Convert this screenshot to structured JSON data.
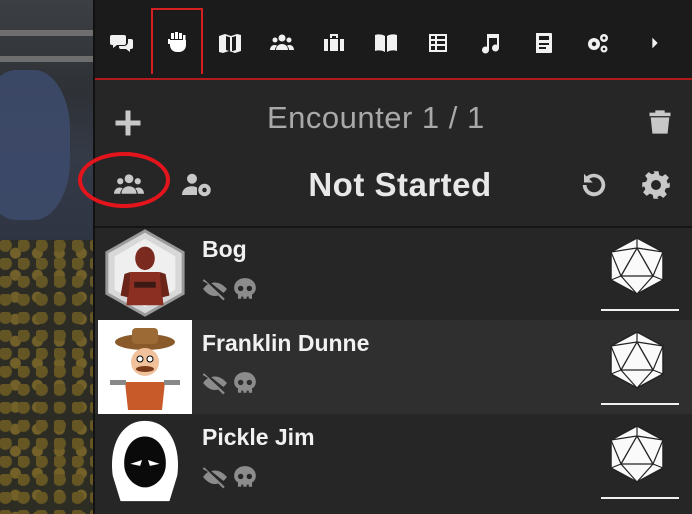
{
  "nav_tabs": [
    {
      "name": "tab-chat",
      "icon": "chat-icon"
    },
    {
      "name": "tab-combat",
      "icon": "fist-icon",
      "active": true
    },
    {
      "name": "tab-scenes",
      "icon": "map-icon"
    },
    {
      "name": "tab-actors",
      "icon": "users-icon"
    },
    {
      "name": "tab-items",
      "icon": "suitcase-icon"
    },
    {
      "name": "tab-journal",
      "icon": "book-icon"
    },
    {
      "name": "tab-tables",
      "icon": "table-icon"
    },
    {
      "name": "tab-playlists",
      "icon": "music-icon"
    },
    {
      "name": "tab-compendium",
      "icon": "atlas-icon"
    },
    {
      "name": "tab-settings",
      "icon": "cogs-icon"
    },
    {
      "name": "tab-more",
      "icon": "chevron-right-icon"
    }
  ],
  "encounter": {
    "title": "Encounter 1 / 1",
    "status": "Not Started"
  },
  "combatants": [
    {
      "name": "Bog",
      "portrait": "bog-portrait"
    },
    {
      "name": "Franklin Dunne",
      "portrait": "franklin-portrait"
    },
    {
      "name": "Pickle Jim",
      "portrait": "pickle-jim-portrait"
    }
  ],
  "colors": {
    "accent": "#d42020",
    "highlight_circle": "#e3141b",
    "sidebar_bg": "#262626",
    "text": "#f1f1f1"
  }
}
